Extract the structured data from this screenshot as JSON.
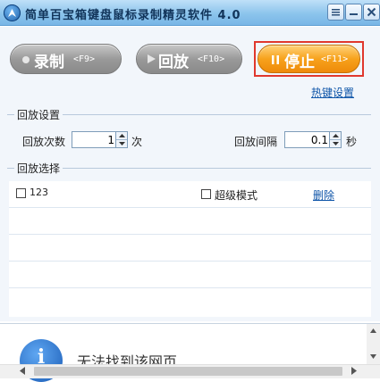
{
  "window": {
    "title": "简单百宝箱键盘鼠标录制精灵软件 4.0",
    "icon": "app-logo-icon"
  },
  "title_buttons": {
    "menu_icon": "menu-icon",
    "minimize_icon": "minimize-icon",
    "close_icon": "close-icon"
  },
  "toolbar": {
    "record": {
      "label": "录制",
      "hotkey": "<F9>",
      "icon": "record-dot-icon",
      "state": "disabled"
    },
    "playback": {
      "label": "回放",
      "hotkey": "<F10>",
      "icon": "play-icon",
      "state": "disabled"
    },
    "stop": {
      "label": "停止",
      "hotkey": "<F11>",
      "icon": "pause-icon",
      "state": "active"
    }
  },
  "hotkey_settings_link": "热键设置",
  "playback_settings": {
    "title": "回放设置",
    "count_label": "回放次数",
    "count_value": "1",
    "count_unit": "次",
    "interval_label": "回放间隔",
    "interval_value": "0.1",
    "interval_unit": "秒"
  },
  "playback_selection": {
    "title": "回放选择",
    "items": [
      {
        "name": "123",
        "checked": false
      }
    ],
    "super_mode_label": "超级模式",
    "super_mode_checked": false,
    "delete_label": "删除"
  },
  "browser": {
    "message": "无法找到该网页",
    "icon": "info-icon"
  },
  "colors": {
    "titlebar": "#8cc4ec",
    "stop_button": "#f7a21c",
    "disabled_button": "#9a9a9a",
    "link": "#0d54a8",
    "highlight_frame": "#e0382e"
  }
}
